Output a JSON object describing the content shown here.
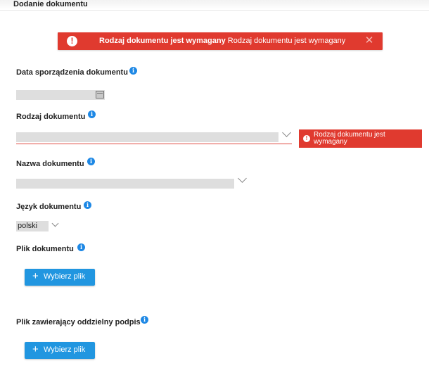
{
  "page": {
    "title": "Dodanie dokumentu"
  },
  "alert": {
    "icon": "exclamation-circle-icon",
    "bold_text": "Rodzaj dokumentu jest wymagany",
    "text": "Rodzaj dokumentu jest wymagany",
    "close_symbol": "✕",
    "color": "#e03a2f"
  },
  "fields": {
    "date": {
      "label": "Data sporządzenia dokumentu",
      "value": ""
    },
    "type": {
      "label": "Rodzaj dokumentu",
      "value": "",
      "error": "Rodzaj dokumentu jest wymagany"
    },
    "name": {
      "label": "Nazwa dokumentu",
      "value": ""
    },
    "language": {
      "label": "Język dokumentu",
      "value": "polski"
    },
    "file": {
      "label": "Plik dokumentu",
      "button": "Wybierz plik"
    },
    "signature_file": {
      "label": "Plik zawierający oddzielny podpis",
      "button": "Wybierz plik"
    }
  },
  "icons": {
    "info": "info-icon",
    "calendar": "calendar-icon",
    "chevron": "chevron-down-icon",
    "plus": "plus-icon"
  },
  "colors": {
    "accent": "#2196e0",
    "error": "#e03a2f",
    "info": "#1e88e5",
    "field": "#dedede"
  }
}
